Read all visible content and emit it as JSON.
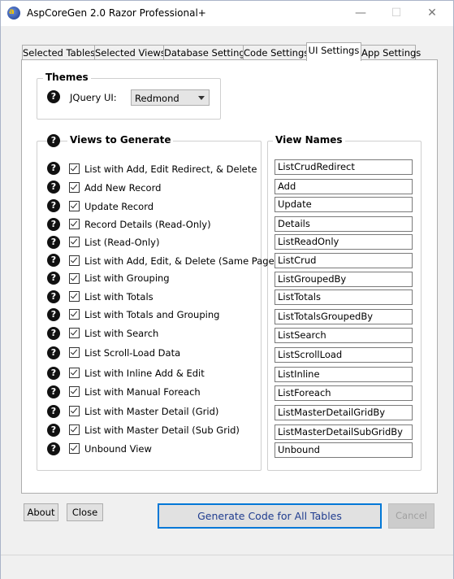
{
  "window": {
    "title": "AspCoreGen 2.0 Razor Professional+",
    "minimize": "—",
    "maximize": "☐",
    "close": "✕"
  },
  "tabs": [
    {
      "label": "Selected Tables"
    },
    {
      "label": "Selected Views"
    },
    {
      "label": "Database Settings"
    },
    {
      "label": "Code Settings"
    },
    {
      "label": "UI Settings"
    },
    {
      "label": "App Settings"
    }
  ],
  "themes": {
    "title": "Themes",
    "jquery_label": "JQuery UI:",
    "jquery_value": "Redmond"
  },
  "views": {
    "title": "Views to Generate",
    "names_title": "View Names",
    "items": [
      {
        "label": "List with Add, Edit Redirect, & Delete",
        "name": "ListCrudRedirect",
        "checked": true
      },
      {
        "label": "Add New Record",
        "name": "Add",
        "checked": true
      },
      {
        "label": "Update Record",
        "name": "Update",
        "checked": true
      },
      {
        "label": "Record Details (Read-Only)",
        "name": "Details",
        "checked": true
      },
      {
        "label": "List (Read-Only)",
        "name": "ListReadOnly",
        "checked": true
      },
      {
        "label": "List with Add, Edit, & Delete (Same Page)",
        "name": "ListCrud",
        "checked": true
      },
      {
        "label": "List with Grouping",
        "name": "ListGroupedBy",
        "checked": true
      },
      {
        "label": "List with Totals",
        "name": "ListTotals",
        "checked": true
      },
      {
        "label": "List with Totals and Grouping",
        "name": "ListTotalsGroupedBy",
        "checked": true
      },
      {
        "label": "List with Search",
        "name": "ListSearch",
        "checked": true
      },
      {
        "label": "List Scroll-Load Data",
        "name": "ListScrollLoad",
        "checked": true
      },
      {
        "label": "List with Inline Add & Edit",
        "name": "ListInline",
        "checked": true
      },
      {
        "label": "List with Manual Foreach",
        "name": "ListForeach",
        "checked": true
      },
      {
        "label": "List with Master Detail (Grid)",
        "name": "ListMasterDetailGridBy",
        "checked": true
      },
      {
        "label": "List with Master Detail (Sub Grid)",
        "name": "ListMasterDetailSubGridBy",
        "checked": true
      },
      {
        "label": "Unbound View",
        "name": "Unbound",
        "checked": true
      }
    ]
  },
  "buttons": {
    "about": "About",
    "close": "Close",
    "generate": "Generate Code for All Tables",
    "cancel": "Cancel"
  },
  "help_glyph": "?"
}
